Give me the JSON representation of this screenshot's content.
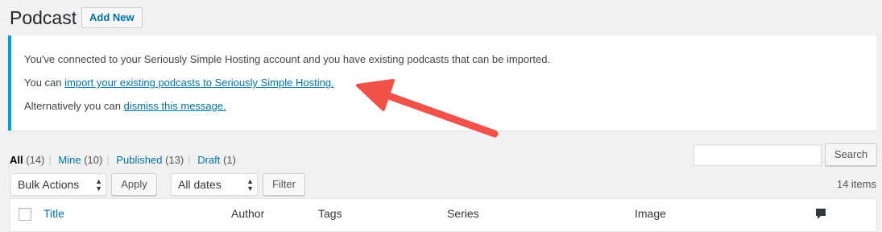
{
  "header": {
    "title": "Podcast",
    "add_new_label": "Add New"
  },
  "notice": {
    "line1": "You've connected to your Seriously Simple Hosting account and you have existing podcasts that can be imported.",
    "line2_prefix": "You can ",
    "line2_link": "import your existing podcasts to Seriously Simple Hosting.",
    "line3_prefix": "Alternatively you can ",
    "line3_link": "dismiss this message."
  },
  "filters": [
    {
      "label": "All",
      "count": "(14)"
    },
    {
      "label": "Mine",
      "count": "(10)"
    },
    {
      "label": "Published",
      "count": "(13)"
    },
    {
      "label": "Draft",
      "count": "(1)"
    }
  ],
  "search": {
    "button_label": "Search",
    "value": ""
  },
  "tablenav": {
    "bulk_actions": "Bulk Actions",
    "apply_label": "Apply",
    "dates": "All dates",
    "filter_label": "Filter",
    "items_count": "14 items"
  },
  "table": {
    "columns": [
      "Title",
      "Author",
      "Tags",
      "Series",
      "Image"
    ]
  },
  "colors": {
    "link": "#0073aa",
    "notice_border": "#00a0d2",
    "arrow": "#f0524a"
  },
  "icons": {
    "comments_column": "comment-bubble-icon",
    "annotation": "red-arrow-icon"
  }
}
